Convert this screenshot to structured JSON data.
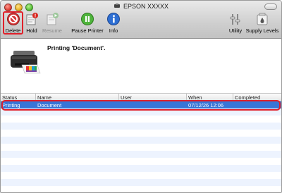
{
  "window": {
    "title": "EPSON XXXXX"
  },
  "toolbar": {
    "delete_label": "Delete",
    "hold_label": "Hold",
    "resume_label": "Resume",
    "pause_label": "Pause Printer",
    "info_label": "Info",
    "utility_label": "Utility",
    "supply_label": "Supply Levels"
  },
  "status": {
    "message": "Printing 'Document'."
  },
  "queue": {
    "columns": [
      "Status",
      "Name",
      "User",
      "When",
      "Completed"
    ],
    "rows": [
      {
        "status": "Printing",
        "name": "Document",
        "user": "",
        "when": "07/12/26 12:06",
        "completed": ""
      }
    ]
  },
  "colors": {
    "selection": "#3875d7",
    "highlight": "#e0202a",
    "stripe": "#edf3fe"
  }
}
